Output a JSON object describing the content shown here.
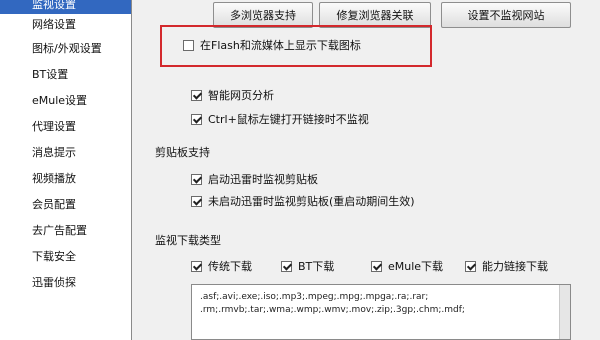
{
  "sidebar": {
    "items": [
      {
        "label": "监视设置",
        "selected": true
      },
      {
        "label": "网络设置"
      },
      {
        "label": "图标/外观设置"
      },
      {
        "label": "BT设置"
      },
      {
        "label": "eMule设置"
      },
      {
        "label": "代理设置"
      },
      {
        "label": "消息提示"
      },
      {
        "label": "视频播放"
      },
      {
        "label": "会员配置"
      },
      {
        "label": "去广告配置"
      },
      {
        "label": "下载安全"
      },
      {
        "label": "迅雷侦探"
      }
    ]
  },
  "toolbar": {
    "browser_btn_1": "多浏览器支持",
    "browser_btn_2": "修复浏览器关联",
    "no_monitor_site_btn": "设置不监视网站"
  },
  "options": {
    "flash_icon": {
      "label": "在Flash和流媒体上显示下载图标",
      "checked": false
    },
    "smart_analysis": {
      "label": "智能网页分析",
      "checked": true
    },
    "ctrl_click": {
      "label": "Ctrl+鼠标左键打开链接时不监视",
      "checked": true
    }
  },
  "clipboard": {
    "title": "剪贴板支持",
    "on_start": {
      "label": "启动迅雷时监视剪贴板",
      "checked": true
    },
    "not_started": {
      "label": "未启动迅雷时监视剪贴板(重启动期间生效)",
      "checked": true
    }
  },
  "download_types": {
    "title": "监视下载类型",
    "types": [
      {
        "label": "传统下载",
        "checked": true
      },
      {
        "label": "BT下载",
        "checked": true
      },
      {
        "label": "eMule下载",
        "checked": true
      },
      {
        "label": "能力链接下载",
        "checked": true
      }
    ],
    "extensions_line1": ".asf;.avi;.exe;.iso;.mp3;.mpeg;.mpg;.mpga;.ra;.rar;",
    "extensions_line2": ".rm;.rmvb;.tar;.wma;.wmp;.wmv;.mov;.zip;.3gp;.chm;.mdf;"
  },
  "colors": {
    "selected_bg": "#3268c0",
    "highlight_border": "#d3282c"
  }
}
